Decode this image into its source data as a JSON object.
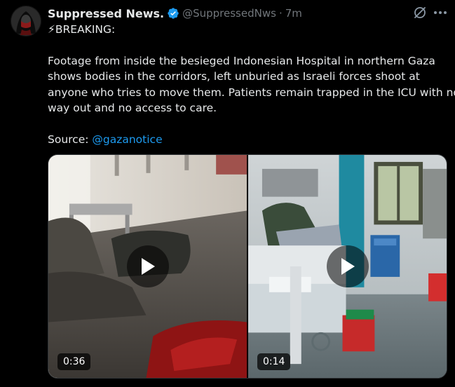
{
  "tweet": {
    "author_name": "Suppressed News.",
    "handle": "@SuppressedNws",
    "separator": "·",
    "time": "7m",
    "body_lines": [
      "⚡BREAKING:",
      "Footage from inside the besieged Indonesian Hospital in northern Gaza",
      "shows bodies in the corridors, left unburied as Israeli forces shoot at",
      "anyone who tries to move them. Patients remain trapped in the ICU with no",
      "way out and no access to care."
    ],
    "source_label": "Source: ",
    "source_mention": "@gazanotice"
  },
  "media": {
    "videos": [
      {
        "duration": "0:36"
      },
      {
        "duration": "0:14"
      }
    ]
  },
  "icons": {
    "verified": "verified-badge-icon",
    "grok": "grok-icon",
    "more": "more-options-icon",
    "play": "play-icon"
  },
  "colors": {
    "background": "#000000",
    "text": "#e7e9ea",
    "muted": "#71767b",
    "accent": "#1d9bf0"
  }
}
